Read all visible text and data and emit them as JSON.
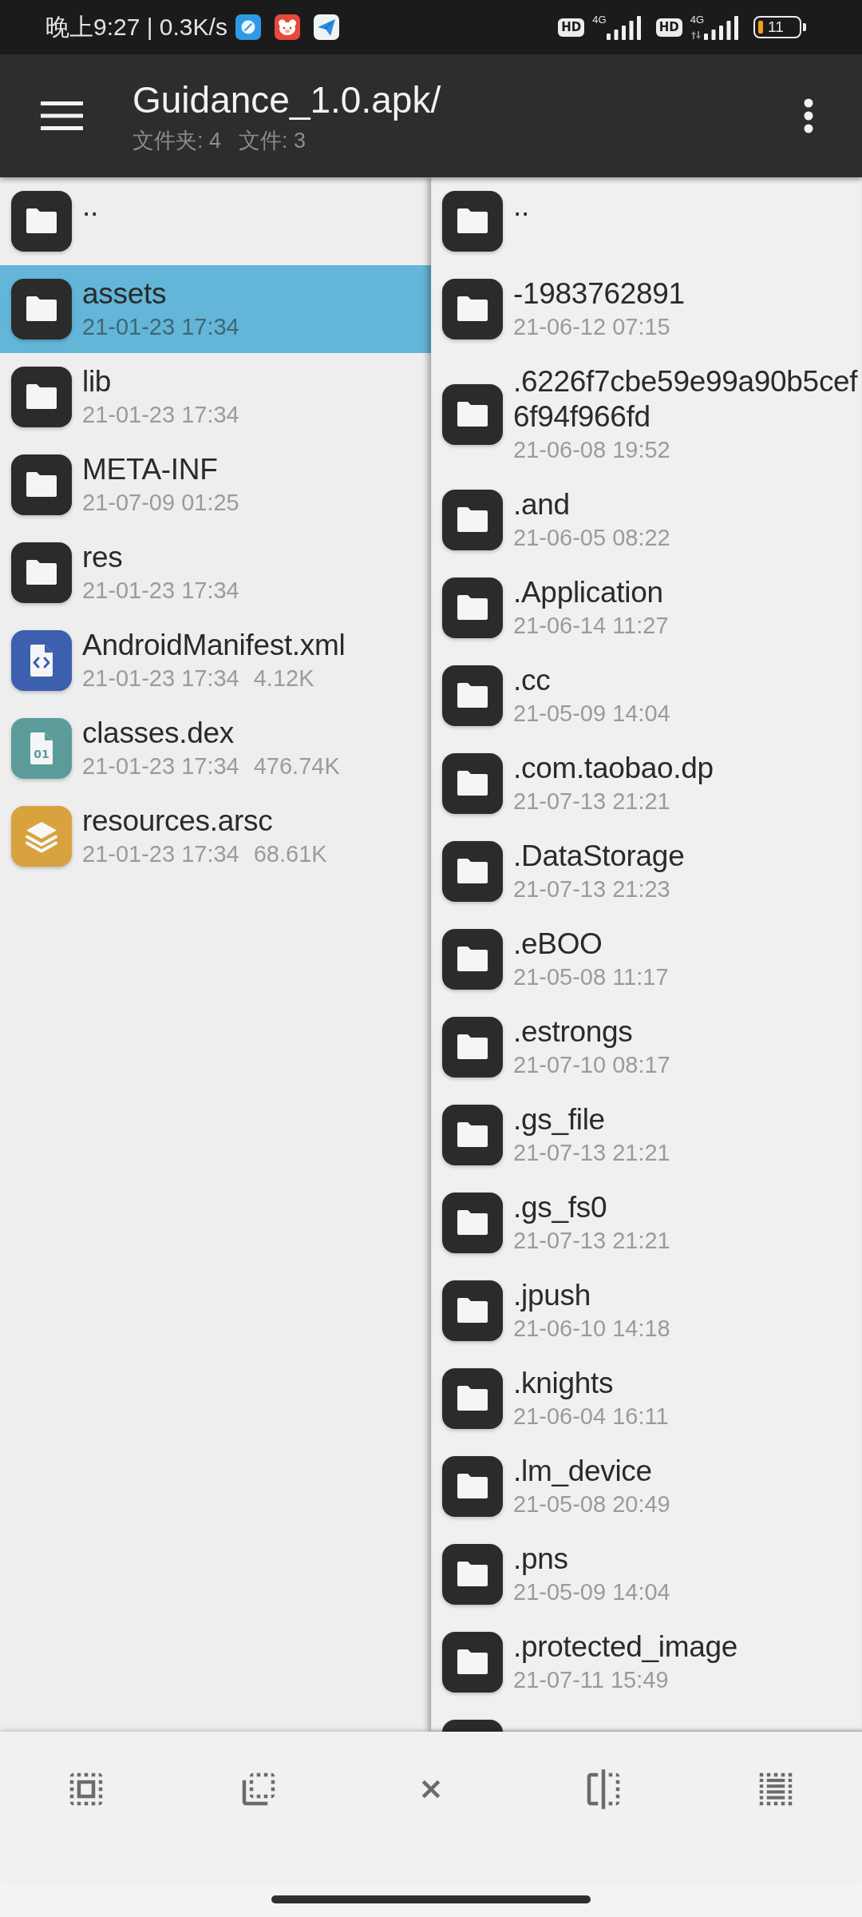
{
  "status_bar": {
    "text": "晚上9:27 | 0.3K/s",
    "signals": [
      {
        "badge": "HD",
        "network": "4G",
        "activity": false
      },
      {
        "badge": "HD",
        "network": "4G",
        "activity": true
      }
    ],
    "battery": {
      "text": "11"
    }
  },
  "header": {
    "title": "Guidance_1.0.apk/",
    "counts": [
      "文件夹: 4",
      "文件: 3"
    ]
  },
  "left_panel": {
    "items": [
      {
        "kind": "folder",
        "name": "..",
        "selected": false
      },
      {
        "kind": "folder",
        "name": "assets",
        "date": "21-01-23 17:34",
        "selected": true
      },
      {
        "kind": "folder",
        "name": "lib",
        "date": "21-01-23 17:34",
        "selected": false
      },
      {
        "kind": "folder",
        "name": "META-INF",
        "date": "21-07-09 01:25",
        "selected": false
      },
      {
        "kind": "folder",
        "name": "res",
        "date": "21-01-23 17:34",
        "selected": false
      },
      {
        "kind": "xml",
        "name": "AndroidManifest.xml",
        "date": "21-01-23 17:34",
        "size": "4.12K",
        "selected": false
      },
      {
        "kind": "dex",
        "name": "classes.dex",
        "date": "21-01-23 17:34",
        "size": "476.74K",
        "icon_label": "01",
        "selected": false
      },
      {
        "kind": "arsc",
        "name": "resources.arsc",
        "date": "21-01-23 17:34",
        "size": "68.61K",
        "selected": false
      }
    ]
  },
  "right_panel": {
    "items": [
      {
        "kind": "folder",
        "name": "..",
        "selected": false
      },
      {
        "kind": "folder",
        "name": "-1983762891",
        "date": "21-06-12 07:15",
        "selected": false
      },
      {
        "kind": "folder",
        "name": ".6226f7cbe59e99a90b5cef6f94f966fd",
        "date": "21-06-08 19:52",
        "selected": false
      },
      {
        "kind": "folder",
        "name": ".and",
        "date": "21-06-05 08:22",
        "selected": false
      },
      {
        "kind": "folder",
        "name": ".Application",
        "date": "21-06-14 11:27",
        "selected": false
      },
      {
        "kind": "folder",
        "name": ".cc",
        "date": "21-05-09 14:04",
        "selected": false
      },
      {
        "kind": "folder",
        "name": ".com.taobao.dp",
        "date": "21-07-13 21:21",
        "selected": false
      },
      {
        "kind": "folder",
        "name": ".DataStorage",
        "date": "21-07-13 21:23",
        "selected": false
      },
      {
        "kind": "folder",
        "name": ".eBOO",
        "date": "21-05-08 11:17",
        "selected": false
      },
      {
        "kind": "folder",
        "name": ".estrongs",
        "date": "21-07-10 08:17",
        "selected": false
      },
      {
        "kind": "folder",
        "name": ".gs_file",
        "date": "21-07-13 21:21",
        "selected": false
      },
      {
        "kind": "folder",
        "name": ".gs_fs0",
        "date": "21-07-13 21:21",
        "selected": false
      },
      {
        "kind": "folder",
        "name": ".jpush",
        "date": "21-06-10 14:18",
        "selected": false
      },
      {
        "kind": "folder",
        "name": ".knights",
        "date": "21-06-04 16:11",
        "selected": false
      },
      {
        "kind": "folder",
        "name": ".lm_device",
        "date": "21-05-08 20:49",
        "selected": false
      },
      {
        "kind": "folder",
        "name": ".pns",
        "date": "21-05-09 14:04",
        "selected": false
      },
      {
        "kind": "folder",
        "name": ".protected_image",
        "date": "21-07-11 15:49",
        "selected": false
      },
      {
        "kind": "folder",
        "selected": false
      }
    ]
  }
}
